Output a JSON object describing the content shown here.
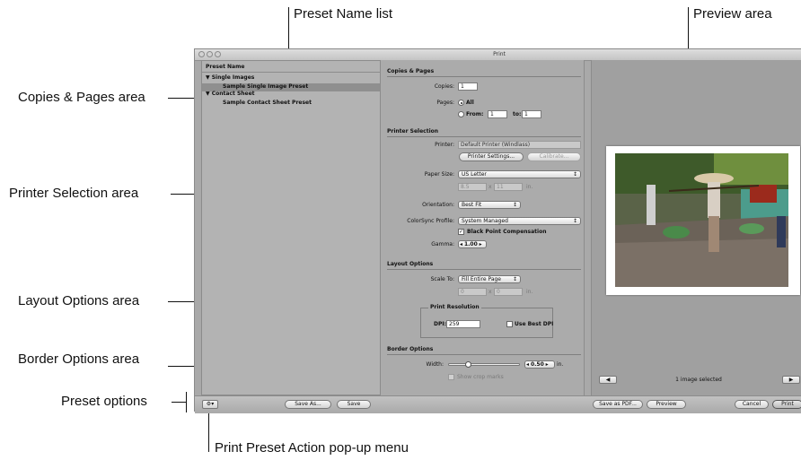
{
  "callouts": {
    "preset_name_list": "Preset Name list",
    "preview_area": "Preview area",
    "copies_pages_area": "Copies & Pages area",
    "printer_selection_area": "Printer Selection area",
    "layout_options_area": "Layout Options area",
    "border_options_area": "Border Options area",
    "preset_options": "Preset options",
    "print_preset_action_menu": "Print Preset Action pop-up menu"
  },
  "window": {
    "title": "Print"
  },
  "preset_list": {
    "header": "Preset Name",
    "groups": [
      {
        "label": "Single Images",
        "items": [
          "Sample Single Image Preset"
        ]
      },
      {
        "label": "Contact Sheet",
        "items": [
          "Sample Contact Sheet Preset"
        ]
      }
    ]
  },
  "copies_pages": {
    "title": "Copies & Pages",
    "copies_label": "Copies:",
    "copies_value": "1",
    "pages_label": "Pages:",
    "all_label": "All",
    "from_label": "From:",
    "from_value": "1",
    "to_label": "to:",
    "to_value": "1"
  },
  "printer_selection": {
    "title": "Printer Selection",
    "printer_label": "Printer:",
    "printer_value": "Default Printer (Windlass)",
    "printer_settings_button": "Printer Settings...",
    "calibrate_button": "Calibrate...",
    "paper_size_label": "Paper Size:",
    "paper_size_value": "US Letter",
    "paper_width": "8.5",
    "paper_x": "x",
    "paper_height": "11",
    "paper_unit": "in.",
    "orientation_label": "Orientation:",
    "orientation_value": "Best Fit",
    "colorsync_label": "ColorSync Profile:",
    "colorsync_value": "System Managed",
    "black_point_label": "Black Point Compensation",
    "black_point_checked": true,
    "gamma_label": "Gamma:",
    "gamma_value": "1.00"
  },
  "layout_options": {
    "title": "Layout Options",
    "scale_label": "Scale To:",
    "scale_value": "Fill Entire Page",
    "width_value": "0",
    "x": "x",
    "height_value": "0",
    "unit": "in.",
    "print_resolution_title": "Print Resolution",
    "dpi_label": "DPI:",
    "dpi_value": "259",
    "use_best_dpi_label": "Use Best DPI"
  },
  "border_options": {
    "title": "Border Options",
    "width_label": "Width:",
    "width_value": "0.50",
    "width_unit": "in.",
    "width_slider_fraction": 0.25,
    "show_crop_marks_label": "Show crop marks"
  },
  "preview": {
    "status": "1 image selected",
    "prev_icon": "left-arrow-icon",
    "next_icon": "right-arrow-icon"
  },
  "bottom_bar": {
    "action_menu_icon": "gear-icon",
    "save_as_button": "Save As...",
    "save_button": "Save",
    "save_as_pdf_button": "Save as PDF...",
    "preview_button": "Preview",
    "cancel_button": "Cancel",
    "print_button": "Print"
  },
  "colors": {
    "window_bg": "#a9a9a9",
    "selected_row": "#8f8f8f",
    "callout_text": "#111111"
  }
}
